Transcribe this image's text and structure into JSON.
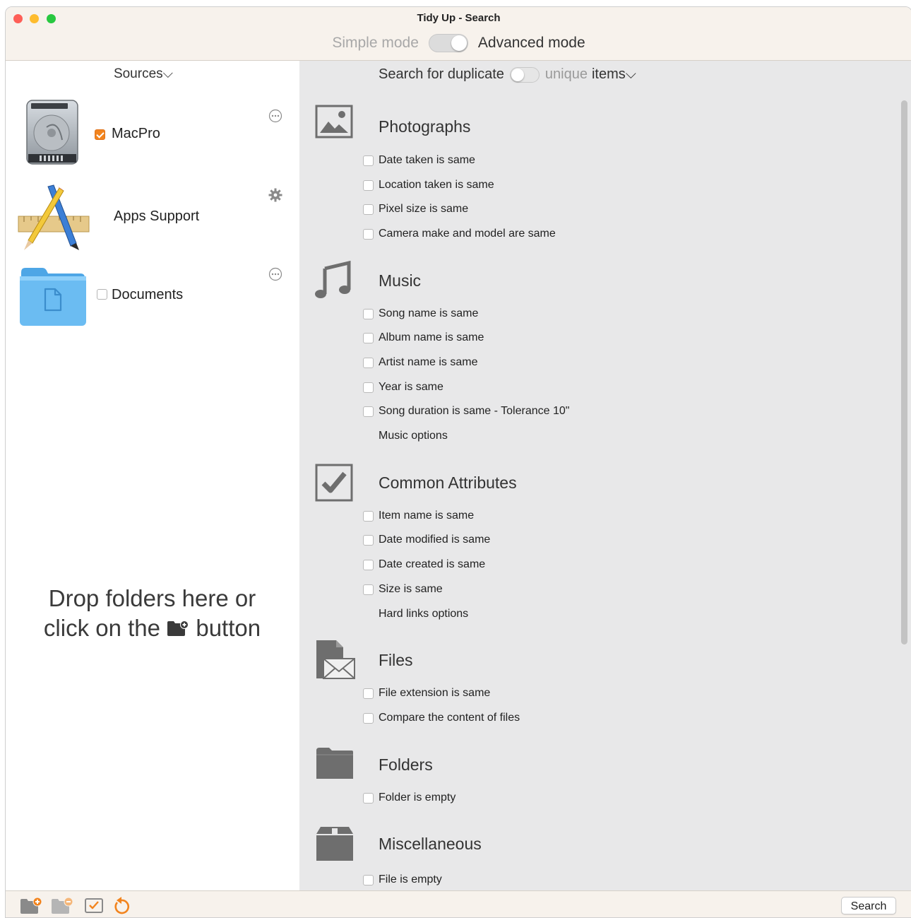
{
  "window": {
    "title": "Tidy Up - Search"
  },
  "mode": {
    "simple_label": "Simple mode",
    "advanced_label": "Advanced mode",
    "advanced_on": true
  },
  "sidebar": {
    "header": "Sources⌵",
    "sources": [
      {
        "label": "MacPro",
        "checked": true,
        "icon": "hard-drive-icon",
        "action_icon": "more-icon"
      },
      {
        "label": "Apps Support",
        "icon": "applications-icon",
        "action_icon": "gear-icon"
      },
      {
        "label": "Documents",
        "checked": false,
        "icon": "folder-icon",
        "action_icon": "more-icon"
      }
    ],
    "drop_hint_line1": "Drop folders here or",
    "drop_hint_before": "click on the",
    "drop_hint_after": "button"
  },
  "search": {
    "prefix": "Search for duplicate",
    "unique": "unique",
    "items": "items⌵",
    "duplicate_mode_on": true
  },
  "sections": {
    "photographs": {
      "title": "Photographs",
      "icon": "photo-icon",
      "options": [
        "Date taken is same",
        "Location taken is same",
        "Pixel size is same",
        "Camera make and model are same"
      ]
    },
    "music": {
      "title": "Music",
      "icon": "music-note-icon",
      "options": [
        "Song name is same",
        "Album name is same",
        "Artist name is same",
        "Year is same",
        "Song duration is same - Tolerance 10\""
      ],
      "extra": "Music options"
    },
    "common": {
      "title": "Common Attributes",
      "icon": "checkbox-icon",
      "options": [
        "Item name is same",
        "Date modified is same",
        "Date created is same",
        "Size is same"
      ],
      "extra": "Hard links options"
    },
    "files": {
      "title": "Files",
      "icon": "file-envelope-icon",
      "options": [
        "File extension is same",
        "Compare the content of files"
      ]
    },
    "folders": {
      "title": "Folders",
      "icon": "folder-icon",
      "options": [
        "Folder is empty"
      ]
    },
    "misc": {
      "title": "Miscellaneous",
      "icon": "box-icon",
      "options": [
        "File is empty"
      ]
    }
  },
  "bottombar": {
    "search_label": "Search"
  },
  "colors": {
    "accent": "#f2841e",
    "panel": "#e8e8e9",
    "chrome": "#f7f2ec"
  }
}
